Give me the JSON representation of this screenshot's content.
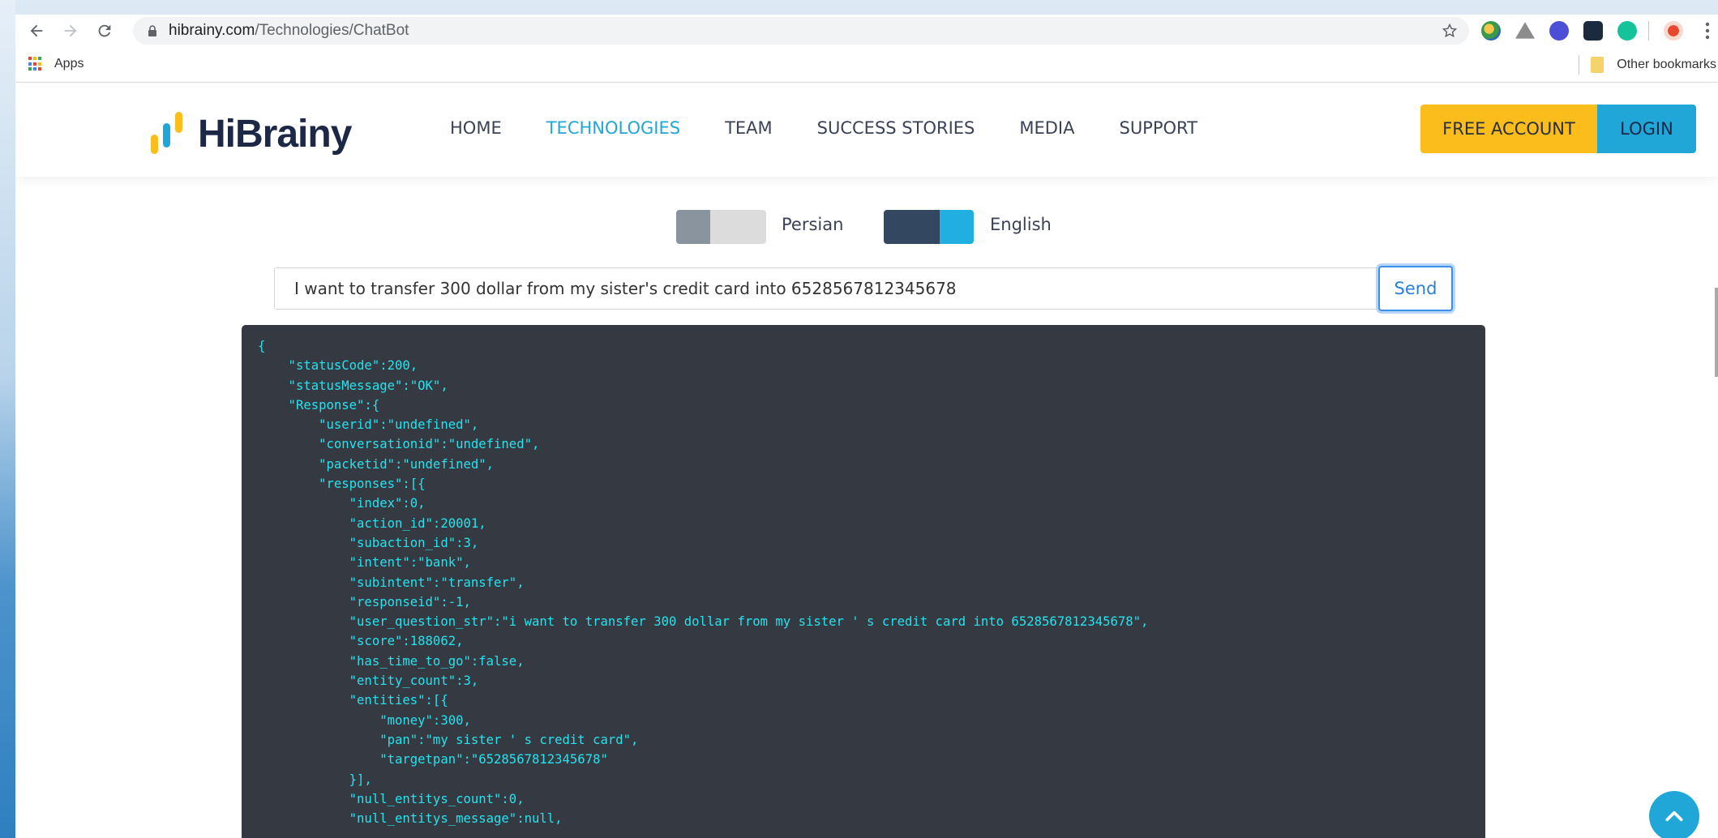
{
  "browser": {
    "url_host": "hibrainy.com",
    "url_path": "/Technologies/ChatBot",
    "bookmarks": {
      "apps_label": "Apps",
      "other_label": "Other bookmarks"
    }
  },
  "site": {
    "logo_text": "HiBrainy",
    "nav": [
      {
        "label": "HOME",
        "active": false
      },
      {
        "label": "TECHNOLOGIES",
        "active": true
      },
      {
        "label": "TEAM",
        "active": false
      },
      {
        "label": "SUCCESS STORIES",
        "active": false
      },
      {
        "label": "MEDIA",
        "active": false
      },
      {
        "label": "SUPPORT",
        "active": false
      }
    ],
    "free_account_label": "FREE ACCOUNT",
    "login_label": "LOGIN"
  },
  "chatbot": {
    "languages": {
      "persian": "Persian",
      "english": "English"
    },
    "query_value": "I want to transfer 300 dollar from my sister's credit card into 6528567812345678",
    "send_label": "Send",
    "response_lines": [
      "{",
      "    \"statusCode\":200,",
      "    \"statusMessage\":\"OK\",",
      "    \"Response\":{",
      "        \"userid\":\"undefined\",",
      "        \"conversationid\":\"undefined\",",
      "        \"packetid\":\"undefined\",",
      "        \"responses\":[{",
      "            \"index\":0,",
      "            \"action_id\":20001,",
      "            \"subaction_id\":3,",
      "            \"intent\":\"bank\",",
      "            \"subintent\":\"transfer\",",
      "            \"responseid\":-1,",
      "            \"user_question_str\":\"i want to transfer 300 dollar from my sister ' s credit card into 6528567812345678\",",
      "            \"score\":188062,",
      "            \"has_time_to_go\":false,",
      "            \"entity_count\":3,",
      "            \"entities\":[{",
      "                \"money\":300,",
      "                \"pan\":\"my sister ' s credit card\",",
      "                \"targetpan\":\"6528567812345678\"",
      "            }],",
      "            \"null_entitys_count\":0,",
      "            \"null_entitys_message\":null,"
    ]
  },
  "colors": {
    "brand_blue": "#21a6d8",
    "brand_yellow": "#fbbd1c",
    "json_bg": "#353941",
    "json_text": "#24e3ef"
  }
}
